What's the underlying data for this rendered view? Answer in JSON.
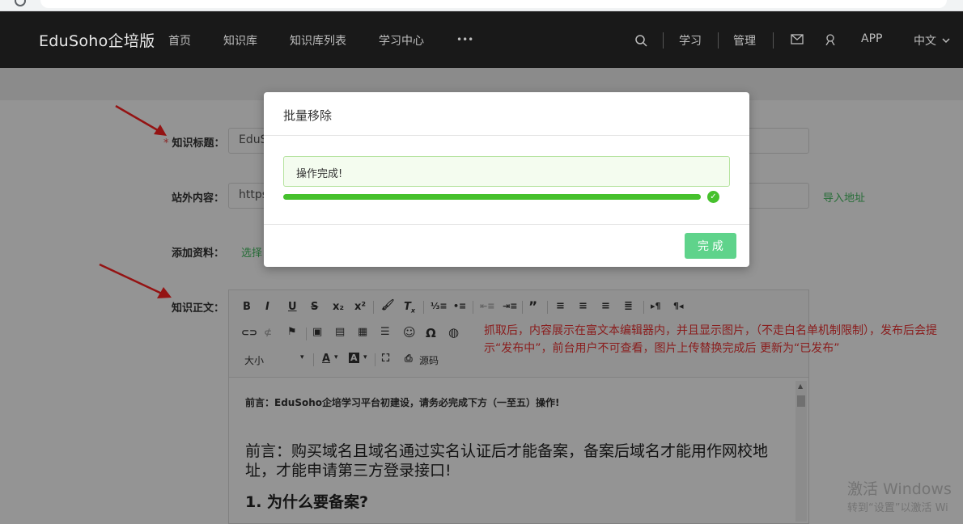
{
  "browser": {
    "url": ""
  },
  "nav": {
    "brand": "EduSoho企培版",
    "items": [
      "首页",
      "知识库",
      "知识库列表",
      "学习中心",
      "•••"
    ],
    "right": {
      "study": "学习",
      "admin": "管理",
      "app": "APP",
      "lang": "中文"
    }
  },
  "form": {
    "title_label": "知识标题：",
    "title_value": "EduS",
    "external_label": "站外内容：",
    "external_value": "https",
    "import_link": "导入地址",
    "attach_label": "添加资料：",
    "attach_link": "选择",
    "body_label": "知识正文："
  },
  "editor": {
    "size_label": "大小",
    "source_label": "源码",
    "intro": "前言：EduSoho企培学习平台初建设，请务必完成下方（一至五）操作!",
    "para": "前言：购买域名且域名通过实名认证后才能备案，备案后域名才能用作网校地址，才能申请第三方登录接口!",
    "heading": "1. 为什么要备案?"
  },
  "note": "抓取后，内容展示在富文本编辑器内，并且显示图片，（不走白名单机制限制），发布后会提示“发布中”，前台用户不可查看，图片上传替换完成后 更新为“已发布”",
  "watermark": {
    "line1": "激活 Windows",
    "line2": "转到“设置”以激活 Wi"
  },
  "modal": {
    "title": "批量移除",
    "message": "操作完成!",
    "progress": 1.0,
    "done_label": "完 成"
  },
  "colors": {
    "progress": "#46c12d",
    "done": "#5fd38b",
    "link": "#43bc60",
    "note": "#ee3333"
  }
}
